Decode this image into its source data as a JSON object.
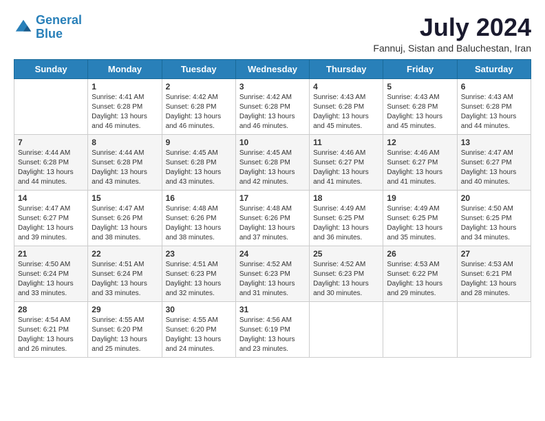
{
  "header": {
    "logo_line1": "General",
    "logo_line2": "Blue",
    "month_year": "July 2024",
    "location": "Fannuj, Sistan and Baluchestan, Iran"
  },
  "days_of_week": [
    "Sunday",
    "Monday",
    "Tuesday",
    "Wednesday",
    "Thursday",
    "Friday",
    "Saturday"
  ],
  "weeks": [
    [
      {
        "day": "",
        "info": ""
      },
      {
        "day": "1",
        "info": "Sunrise: 4:41 AM\nSunset: 6:28 PM\nDaylight: 13 hours and 46 minutes."
      },
      {
        "day": "2",
        "info": "Sunrise: 4:42 AM\nSunset: 6:28 PM\nDaylight: 13 hours and 46 minutes."
      },
      {
        "day": "3",
        "info": "Sunrise: 4:42 AM\nSunset: 6:28 PM\nDaylight: 13 hours and 46 minutes."
      },
      {
        "day": "4",
        "info": "Sunrise: 4:43 AM\nSunset: 6:28 PM\nDaylight: 13 hours and 45 minutes."
      },
      {
        "day": "5",
        "info": "Sunrise: 4:43 AM\nSunset: 6:28 PM\nDaylight: 13 hours and 45 minutes."
      },
      {
        "day": "6",
        "info": "Sunrise: 4:43 AM\nSunset: 6:28 PM\nDaylight: 13 hours and 44 minutes."
      }
    ],
    [
      {
        "day": "7",
        "info": "Sunrise: 4:44 AM\nSunset: 6:28 PM\nDaylight: 13 hours and 44 minutes."
      },
      {
        "day": "8",
        "info": "Sunrise: 4:44 AM\nSunset: 6:28 PM\nDaylight: 13 hours and 43 minutes."
      },
      {
        "day": "9",
        "info": "Sunrise: 4:45 AM\nSunset: 6:28 PM\nDaylight: 13 hours and 43 minutes."
      },
      {
        "day": "10",
        "info": "Sunrise: 4:45 AM\nSunset: 6:28 PM\nDaylight: 13 hours and 42 minutes."
      },
      {
        "day": "11",
        "info": "Sunrise: 4:46 AM\nSunset: 6:27 PM\nDaylight: 13 hours and 41 minutes."
      },
      {
        "day": "12",
        "info": "Sunrise: 4:46 AM\nSunset: 6:27 PM\nDaylight: 13 hours and 41 minutes."
      },
      {
        "day": "13",
        "info": "Sunrise: 4:47 AM\nSunset: 6:27 PM\nDaylight: 13 hours and 40 minutes."
      }
    ],
    [
      {
        "day": "14",
        "info": "Sunrise: 4:47 AM\nSunset: 6:27 PM\nDaylight: 13 hours and 39 minutes."
      },
      {
        "day": "15",
        "info": "Sunrise: 4:47 AM\nSunset: 6:26 PM\nDaylight: 13 hours and 38 minutes."
      },
      {
        "day": "16",
        "info": "Sunrise: 4:48 AM\nSunset: 6:26 PM\nDaylight: 13 hours and 38 minutes."
      },
      {
        "day": "17",
        "info": "Sunrise: 4:48 AM\nSunset: 6:26 PM\nDaylight: 13 hours and 37 minutes."
      },
      {
        "day": "18",
        "info": "Sunrise: 4:49 AM\nSunset: 6:25 PM\nDaylight: 13 hours and 36 minutes."
      },
      {
        "day": "19",
        "info": "Sunrise: 4:49 AM\nSunset: 6:25 PM\nDaylight: 13 hours and 35 minutes."
      },
      {
        "day": "20",
        "info": "Sunrise: 4:50 AM\nSunset: 6:25 PM\nDaylight: 13 hours and 34 minutes."
      }
    ],
    [
      {
        "day": "21",
        "info": "Sunrise: 4:50 AM\nSunset: 6:24 PM\nDaylight: 13 hours and 33 minutes."
      },
      {
        "day": "22",
        "info": "Sunrise: 4:51 AM\nSunset: 6:24 PM\nDaylight: 13 hours and 33 minutes."
      },
      {
        "day": "23",
        "info": "Sunrise: 4:51 AM\nSunset: 6:23 PM\nDaylight: 13 hours and 32 minutes."
      },
      {
        "day": "24",
        "info": "Sunrise: 4:52 AM\nSunset: 6:23 PM\nDaylight: 13 hours and 31 minutes."
      },
      {
        "day": "25",
        "info": "Sunrise: 4:52 AM\nSunset: 6:23 PM\nDaylight: 13 hours and 30 minutes."
      },
      {
        "day": "26",
        "info": "Sunrise: 4:53 AM\nSunset: 6:22 PM\nDaylight: 13 hours and 29 minutes."
      },
      {
        "day": "27",
        "info": "Sunrise: 4:53 AM\nSunset: 6:21 PM\nDaylight: 13 hours and 28 minutes."
      }
    ],
    [
      {
        "day": "28",
        "info": "Sunrise: 4:54 AM\nSunset: 6:21 PM\nDaylight: 13 hours and 26 minutes."
      },
      {
        "day": "29",
        "info": "Sunrise: 4:55 AM\nSunset: 6:20 PM\nDaylight: 13 hours and 25 minutes."
      },
      {
        "day": "30",
        "info": "Sunrise: 4:55 AM\nSunset: 6:20 PM\nDaylight: 13 hours and 24 minutes."
      },
      {
        "day": "31",
        "info": "Sunrise: 4:56 AM\nSunset: 6:19 PM\nDaylight: 13 hours and 23 minutes."
      },
      {
        "day": "",
        "info": ""
      },
      {
        "day": "",
        "info": ""
      },
      {
        "day": "",
        "info": ""
      }
    ]
  ]
}
